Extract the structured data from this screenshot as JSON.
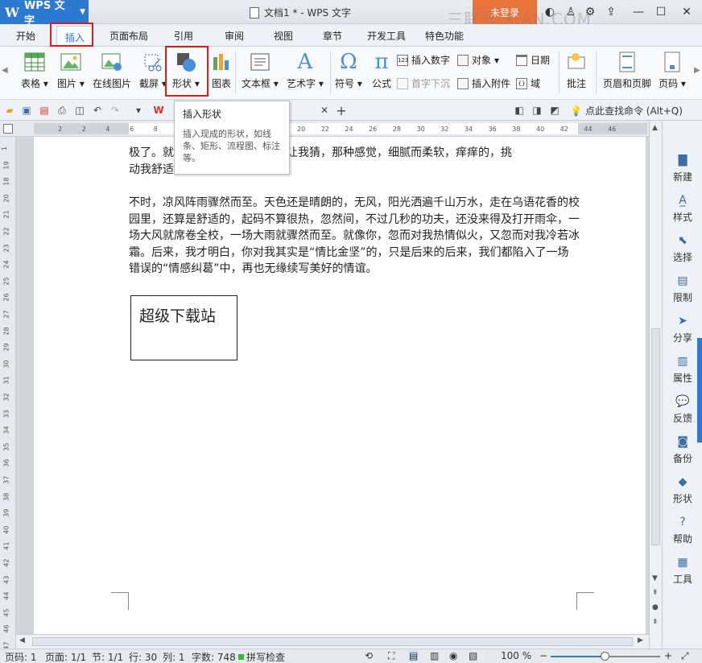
{
  "app": {
    "logo_text": "WPS 文字",
    "doc_title": "文档1 * - WPS 文字",
    "login_label": "未登录",
    "watermark": "三联号 XIAN.COM"
  },
  "menu_tabs": [
    "开始",
    "插入",
    "页面布局",
    "引用",
    "审阅",
    "视图",
    "章节",
    "开发工具",
    "特色功能"
  ],
  "ribbon": {
    "table": "表格",
    "picture": "图片",
    "online_picture": "在线图片",
    "screenshot": "截屏",
    "shape": "形状",
    "chart": "图表",
    "textbox": "文本框",
    "wordart": "艺术字",
    "symbol": "符号",
    "formula": "公式",
    "insert_number": "插入数字",
    "object": "对象",
    "date": "日期",
    "drop_cap": "首字下沉",
    "attachment": "插入附件",
    "field": "域",
    "comment": "批注",
    "header_footer": "页眉和页脚",
    "page_number": "页码"
  },
  "tooltip": {
    "title": "插入形状",
    "description": "插入现成的形状，如线条、矩形、流程图、标注等。"
  },
  "quickbar": {
    "search_command": "点此查找命令 (Alt+Q)"
  },
  "document": {
    "para1_line1": "极了。就像你在我手掌心写着字让我猜，那种感觉，细腻而柔软，痒痒的，挑",
    "para1_line2": "动我舒适",
    "para2": "不时，凉风阵雨骤然而至。天色还是晴朗的，无风，阳光洒遍千山万水，走在乌语花香的校园里，还算是舒适的，起码不算很热，忽然间，不过几秒的功夫，还没来得及打开雨伞，一场大风就席卷全校，一场大雨就骤然而至。就像你，忽而对我热情似火，又忽而对我冷若冰霜。后来，我才明白，你对我其实是“情比金坚”的，只是后来的后来，我们都陷入了一场错误的“情感纠葛”中，再也无缘续写美好的情谊。",
    "textbox_text": "超级下载站"
  },
  "right_panel": [
    "新建",
    "样式",
    "选择",
    "限制",
    "分享",
    "属性",
    "反馈",
    "备份",
    "形状",
    "帮助",
    "工具"
  ],
  "ruler": {
    "top_numbers": [
      "2",
      "2",
      "4",
      "6",
      "8",
      "10",
      "12",
      "14",
      "16",
      "18",
      "20",
      "22",
      "24",
      "26",
      "28",
      "30",
      "32",
      "34",
      "36",
      "38",
      "40",
      "42",
      "44",
      "46"
    ],
    "left_numbers": [
      "1",
      "19",
      "18",
      "20",
      "21",
      "22",
      "23",
      "24",
      "25",
      "26",
      "27",
      "28",
      "29",
      "30",
      "31",
      "32",
      "33",
      "34",
      "35",
      "36",
      "37",
      "38",
      "39",
      "40",
      "41",
      "42",
      "43",
      "44",
      "45",
      "46",
      "47"
    ]
  },
  "status": {
    "page_num": "页码: 1",
    "pages": "页面: 1/1",
    "section": "节: 1/1",
    "line": "行: 30",
    "column": "列: 1",
    "word_count": "字数: 748",
    "spellcheck": "拼写检查",
    "zoom": "100 %",
    "zoom_fraction": 0.5
  },
  "colors": {
    "accent": "#2b79d1",
    "login": "#e8733d",
    "highlight_box": "#d91c1c"
  }
}
